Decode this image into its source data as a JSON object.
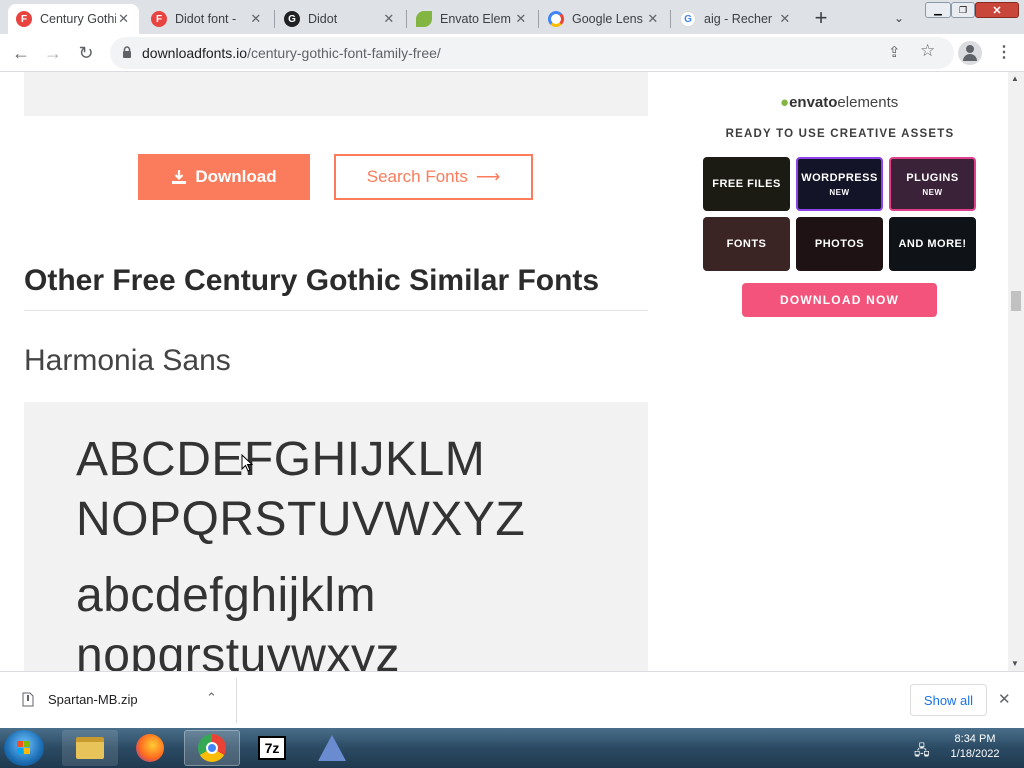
{
  "browser": {
    "tabs": [
      {
        "title": "Century Gothic",
        "favicon_color": "#e8433f",
        "favicon_letter": "F",
        "active": true
      },
      {
        "title": "Didot font - ",
        "favicon_color": "#e8433f",
        "favicon_letter": "F",
        "active": false
      },
      {
        "title": "Didot",
        "favicon_color": "#202124",
        "favicon_letter": "G",
        "active": false
      },
      {
        "title": "Envato Elem",
        "favicon_color": "#82b541",
        "favicon_letter": "",
        "active": false
      },
      {
        "title": "Google Lens",
        "favicon_color": "#4285f4",
        "favicon_letter": "",
        "active": false
      },
      {
        "title": "aig - Recher",
        "favicon_color": "#ffffff",
        "favicon_letter": "G",
        "active": false
      }
    ],
    "new_tab_icon": "+",
    "url_domain": "downloadfonts.io",
    "url_path": "/century-gothic-font-family-free/"
  },
  "page": {
    "download_label": "Download",
    "search_fonts_label": "Search Fonts",
    "section_title": "Other Free Century Gothic Similar Fonts",
    "font_name": "Harmonia Sans",
    "sample_upper_1": "ABCDEFGHIJKLM",
    "sample_upper_2": "NOPQRSTUVWXYZ",
    "sample_lower_1": "abcdefghijklm",
    "sample_lower_2": "nopqrstuvwxyz"
  },
  "ad": {
    "logo_text": "envato",
    "logo_text_2": "elements",
    "tagline": "READY TO USE CREATIVE ASSETS",
    "tiles": [
      {
        "label": "FREE FILES",
        "badge": "",
        "color": "#1b1b14"
      },
      {
        "label": "WORDPRESS",
        "badge": "NEW",
        "color": "#141428"
      },
      {
        "label": "PLUGINS",
        "badge": "NEW",
        "color": "#3a2238"
      },
      {
        "label": "FONTS",
        "badge": "",
        "color": "#3a2524"
      },
      {
        "label": "PHOTOS",
        "badge": "",
        "color": "#1e1214"
      },
      {
        "label": "AND MORE!",
        "badge": "",
        "color": "#0f1216"
      }
    ],
    "cta": "DOWNLOAD NOW"
  },
  "download_bar": {
    "file_name": "Spartan-MB.zip",
    "show_all": "Show all"
  },
  "taskbar": {
    "time": "8:34 PM",
    "date": "1/18/2022"
  },
  "colors": {
    "accent": "#fa7c5c",
    "cta_pink": "#f2547b",
    "badge_purple": "#8e44e8",
    "badge_pink": "#e0408a"
  }
}
